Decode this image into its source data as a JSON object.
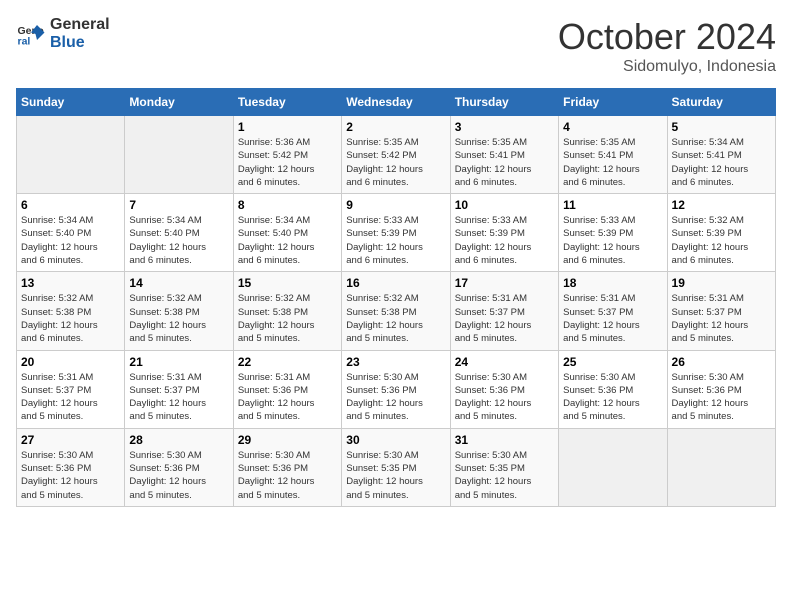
{
  "logo": {
    "line1": "General",
    "line2": "Blue"
  },
  "title": "October 2024",
  "subtitle": "Sidomulyo, Indonesia",
  "weekdays": [
    "Sunday",
    "Monday",
    "Tuesday",
    "Wednesday",
    "Thursday",
    "Friday",
    "Saturday"
  ],
  "weeks": [
    [
      {
        "day": "",
        "info": ""
      },
      {
        "day": "",
        "info": ""
      },
      {
        "day": "1",
        "info": "Sunrise: 5:36 AM\nSunset: 5:42 PM\nDaylight: 12 hours\nand 6 minutes."
      },
      {
        "day": "2",
        "info": "Sunrise: 5:35 AM\nSunset: 5:42 PM\nDaylight: 12 hours\nand 6 minutes."
      },
      {
        "day": "3",
        "info": "Sunrise: 5:35 AM\nSunset: 5:41 PM\nDaylight: 12 hours\nand 6 minutes."
      },
      {
        "day": "4",
        "info": "Sunrise: 5:35 AM\nSunset: 5:41 PM\nDaylight: 12 hours\nand 6 minutes."
      },
      {
        "day": "5",
        "info": "Sunrise: 5:34 AM\nSunset: 5:41 PM\nDaylight: 12 hours\nand 6 minutes."
      }
    ],
    [
      {
        "day": "6",
        "info": "Sunrise: 5:34 AM\nSunset: 5:40 PM\nDaylight: 12 hours\nand 6 minutes."
      },
      {
        "day": "7",
        "info": "Sunrise: 5:34 AM\nSunset: 5:40 PM\nDaylight: 12 hours\nand 6 minutes."
      },
      {
        "day": "8",
        "info": "Sunrise: 5:34 AM\nSunset: 5:40 PM\nDaylight: 12 hours\nand 6 minutes."
      },
      {
        "day": "9",
        "info": "Sunrise: 5:33 AM\nSunset: 5:39 PM\nDaylight: 12 hours\nand 6 minutes."
      },
      {
        "day": "10",
        "info": "Sunrise: 5:33 AM\nSunset: 5:39 PM\nDaylight: 12 hours\nand 6 minutes."
      },
      {
        "day": "11",
        "info": "Sunrise: 5:33 AM\nSunset: 5:39 PM\nDaylight: 12 hours\nand 6 minutes."
      },
      {
        "day": "12",
        "info": "Sunrise: 5:32 AM\nSunset: 5:39 PM\nDaylight: 12 hours\nand 6 minutes."
      }
    ],
    [
      {
        "day": "13",
        "info": "Sunrise: 5:32 AM\nSunset: 5:38 PM\nDaylight: 12 hours\nand 6 minutes."
      },
      {
        "day": "14",
        "info": "Sunrise: 5:32 AM\nSunset: 5:38 PM\nDaylight: 12 hours\nand 5 minutes."
      },
      {
        "day": "15",
        "info": "Sunrise: 5:32 AM\nSunset: 5:38 PM\nDaylight: 12 hours\nand 5 minutes."
      },
      {
        "day": "16",
        "info": "Sunrise: 5:32 AM\nSunset: 5:38 PM\nDaylight: 12 hours\nand 5 minutes."
      },
      {
        "day": "17",
        "info": "Sunrise: 5:31 AM\nSunset: 5:37 PM\nDaylight: 12 hours\nand 5 minutes."
      },
      {
        "day": "18",
        "info": "Sunrise: 5:31 AM\nSunset: 5:37 PM\nDaylight: 12 hours\nand 5 minutes."
      },
      {
        "day": "19",
        "info": "Sunrise: 5:31 AM\nSunset: 5:37 PM\nDaylight: 12 hours\nand 5 minutes."
      }
    ],
    [
      {
        "day": "20",
        "info": "Sunrise: 5:31 AM\nSunset: 5:37 PM\nDaylight: 12 hours\nand 5 minutes."
      },
      {
        "day": "21",
        "info": "Sunrise: 5:31 AM\nSunset: 5:37 PM\nDaylight: 12 hours\nand 5 minutes."
      },
      {
        "day": "22",
        "info": "Sunrise: 5:31 AM\nSunset: 5:36 PM\nDaylight: 12 hours\nand 5 minutes."
      },
      {
        "day": "23",
        "info": "Sunrise: 5:30 AM\nSunset: 5:36 PM\nDaylight: 12 hours\nand 5 minutes."
      },
      {
        "day": "24",
        "info": "Sunrise: 5:30 AM\nSunset: 5:36 PM\nDaylight: 12 hours\nand 5 minutes."
      },
      {
        "day": "25",
        "info": "Sunrise: 5:30 AM\nSunset: 5:36 PM\nDaylight: 12 hours\nand 5 minutes."
      },
      {
        "day": "26",
        "info": "Sunrise: 5:30 AM\nSunset: 5:36 PM\nDaylight: 12 hours\nand 5 minutes."
      }
    ],
    [
      {
        "day": "27",
        "info": "Sunrise: 5:30 AM\nSunset: 5:36 PM\nDaylight: 12 hours\nand 5 minutes."
      },
      {
        "day": "28",
        "info": "Sunrise: 5:30 AM\nSunset: 5:36 PM\nDaylight: 12 hours\nand 5 minutes."
      },
      {
        "day": "29",
        "info": "Sunrise: 5:30 AM\nSunset: 5:36 PM\nDaylight: 12 hours\nand 5 minutes."
      },
      {
        "day": "30",
        "info": "Sunrise: 5:30 AM\nSunset: 5:35 PM\nDaylight: 12 hours\nand 5 minutes."
      },
      {
        "day": "31",
        "info": "Sunrise: 5:30 AM\nSunset: 5:35 PM\nDaylight: 12 hours\nand 5 minutes."
      },
      {
        "day": "",
        "info": ""
      },
      {
        "day": "",
        "info": ""
      }
    ]
  ]
}
